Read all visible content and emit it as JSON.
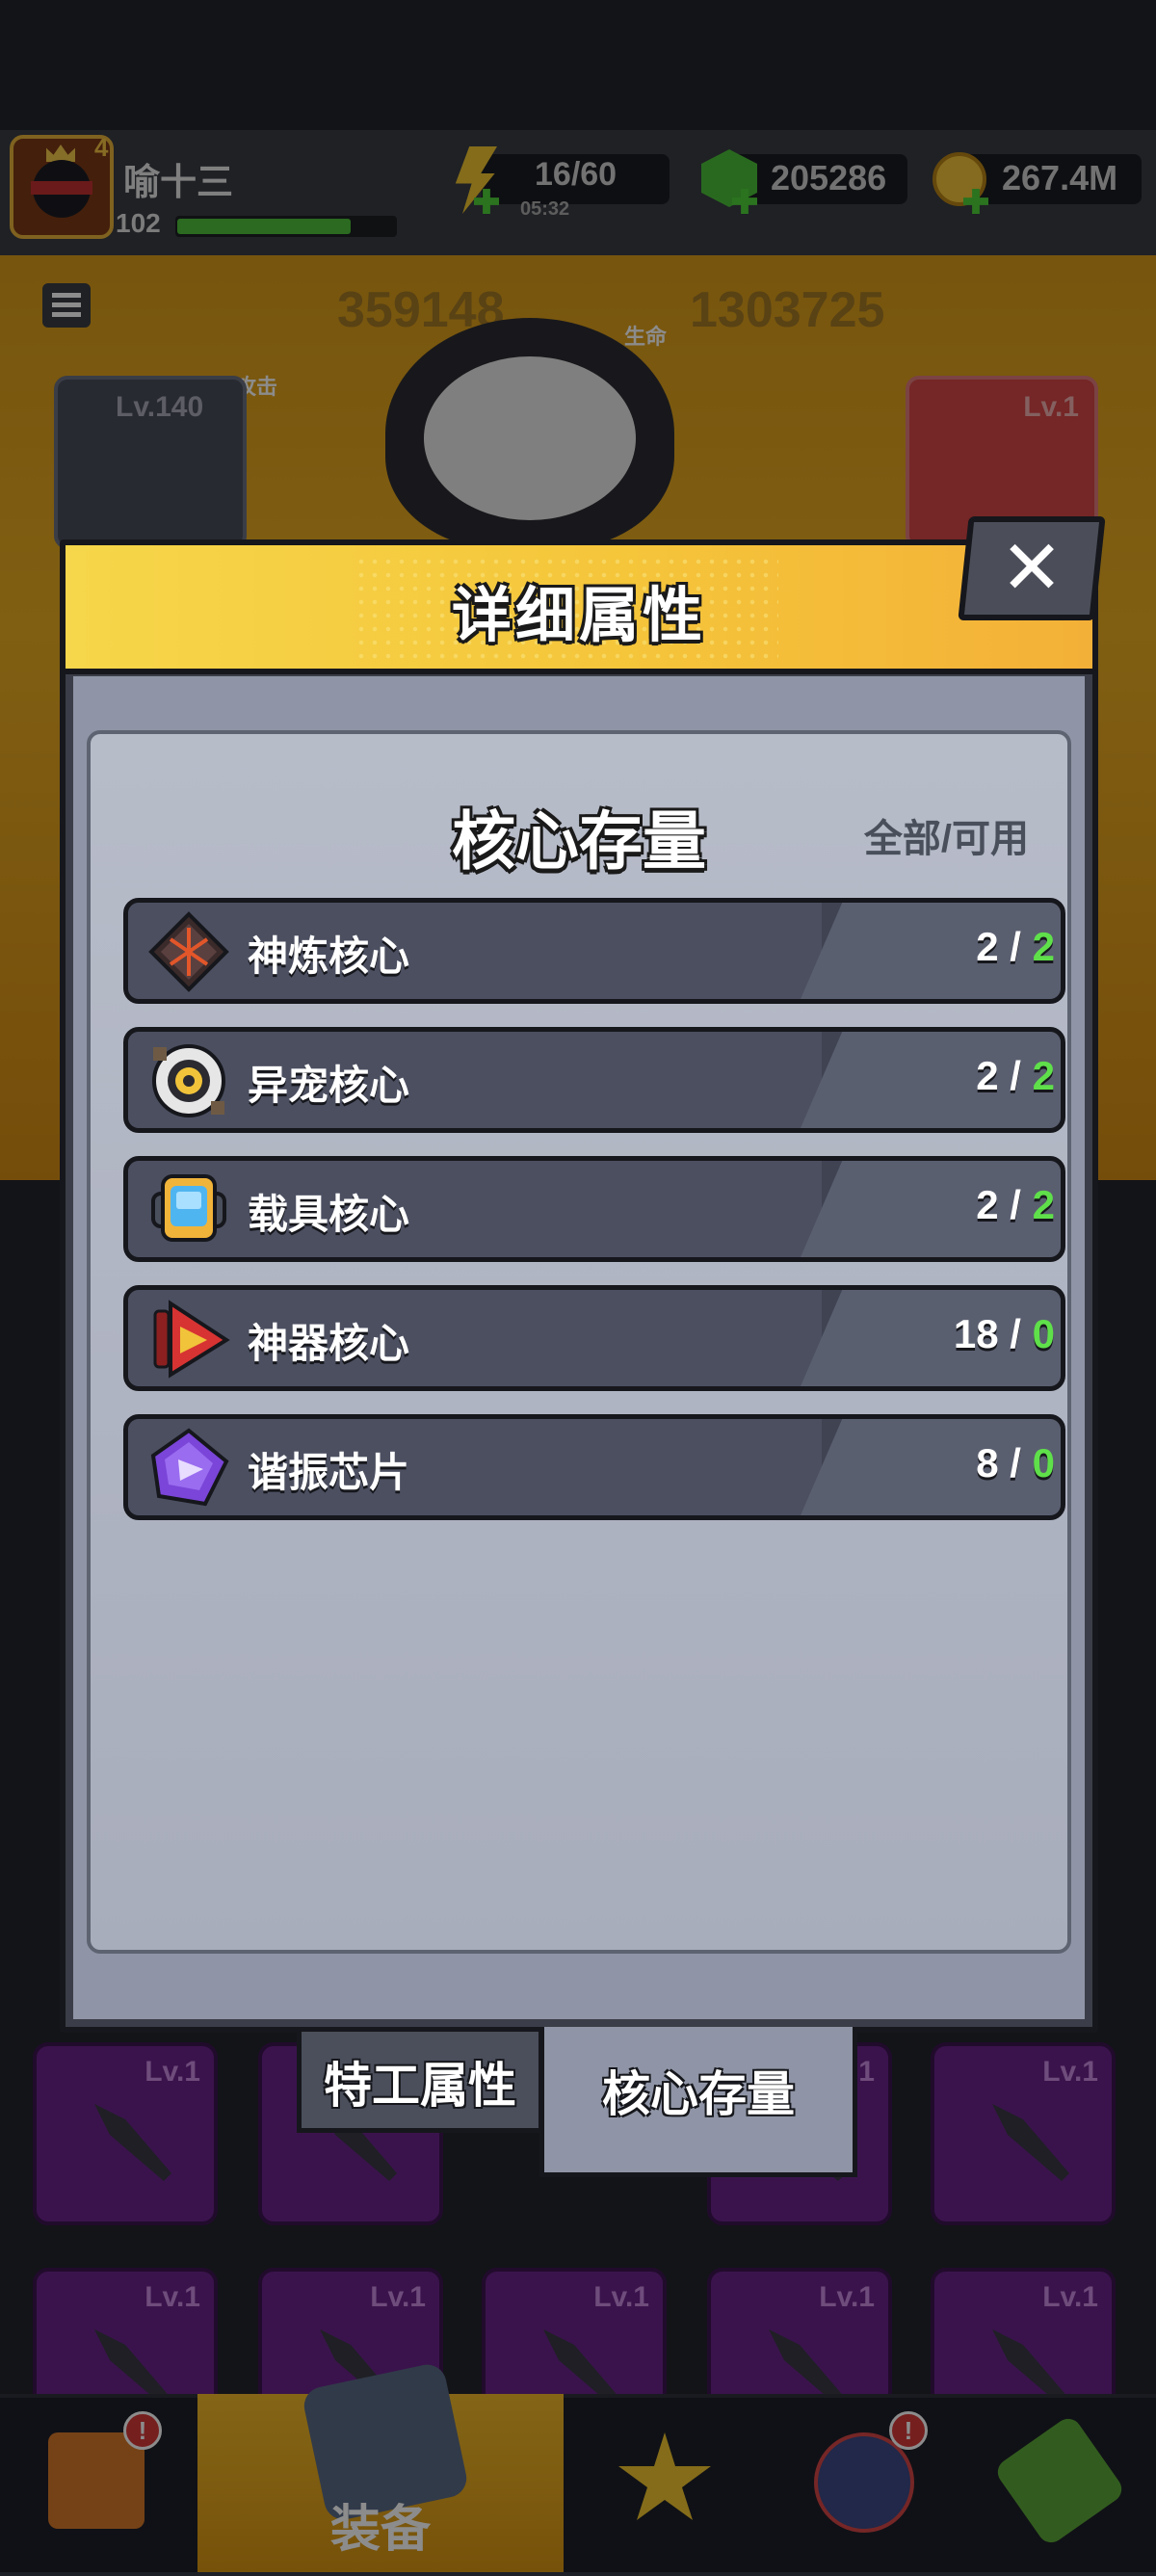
{
  "header": {
    "player_name": "喻十三",
    "player_level": "102",
    "vip_level": "4",
    "stamina": "16/60",
    "stamina_timer": "05:32",
    "gems": "205286",
    "coins": "267.4M"
  },
  "stats": {
    "attack_label": "攻击",
    "attack_value": "359148",
    "hp_label": "生命",
    "hp_value": "1303725",
    "left_card_level": "Lv.140",
    "right_card_level": "Lv.1"
  },
  "equipment_grid": {
    "level_label": "Lv.1"
  },
  "bottom_nav": {
    "active_label": "装备"
  },
  "modal": {
    "title": "详细属性",
    "close_icon": "close-icon",
    "panel_title": "核心存量",
    "panel_subtitle": "全部/可用",
    "rows": [
      {
        "name": "神炼核心",
        "total": "2",
        "available": "2",
        "icon": "divine-core-icon"
      },
      {
        "name": "异宠核心",
        "total": "2",
        "available": "2",
        "icon": "pet-core-icon"
      },
      {
        "name": "载具核心",
        "total": "2",
        "available": "2",
        "icon": "vehicle-core-icon"
      },
      {
        "name": "神器核心",
        "total": "18",
        "available": "0",
        "icon": "artifact-core-icon"
      },
      {
        "name": "谐振芯片",
        "total": "8",
        "available": "0",
        "icon": "resonance-chip-icon"
      }
    ],
    "tabs": [
      {
        "label": "特工属性",
        "active": false
      },
      {
        "label": "核心存量",
        "active": true
      }
    ]
  },
  "colors": {
    "header_yellow": "#f5c53a",
    "available_green": "#5fe04a",
    "row_dark": "#3f4352"
  }
}
